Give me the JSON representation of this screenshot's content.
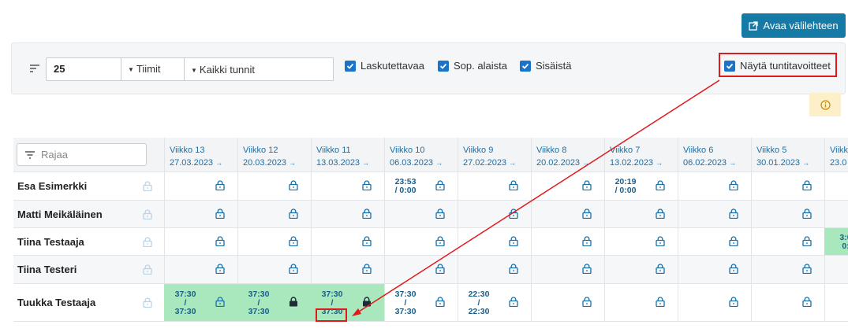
{
  "header": {
    "open_tab_label": "Avaa välilehteen"
  },
  "filters": {
    "count_value": "25",
    "team_select": "Tiimit",
    "hours_select": "Kaikki tunnit",
    "checkboxes": [
      {
        "label": "Laskutettavaa",
        "checked": true
      },
      {
        "label": "Sop. alaista",
        "checked": true
      },
      {
        "label": "Sisäistä",
        "checked": true
      }
    ],
    "show_targets_label": "Näytä tuntitavoitteet",
    "show_targets_checked": true
  },
  "table": {
    "search_placeholder": "Rajaa",
    "weeks": [
      {
        "label": "Viikko 13",
        "date": "27.03.2023"
      },
      {
        "label": "Viikko 12",
        "date": "20.03.2023"
      },
      {
        "label": "Viikko 11",
        "date": "13.03.2023"
      },
      {
        "label": "Viikko 10",
        "date": "06.03.2023"
      },
      {
        "label": "Viikko 9",
        "date": "27.02.2023"
      },
      {
        "label": "Viikko 8",
        "date": "20.02.2023"
      },
      {
        "label": "Viikko 7",
        "date": "13.02.2023"
      },
      {
        "label": "Viikko 6",
        "date": "06.02.2023"
      },
      {
        "label": "Viikko 5",
        "date": "30.01.2023"
      },
      {
        "label": "Viikk",
        "date": "23.0"
      }
    ],
    "week_arrow": "→",
    "rows": [
      {
        "name": "Esa Esimerkki",
        "cells": [
          {
            "v1": "",
            "v2": "",
            "v3": ""
          },
          {
            "v1": "",
            "v2": "",
            "v3": ""
          },
          {
            "v1": "",
            "v2": "",
            "v3": ""
          },
          {
            "v1": "23:53",
            "v2": "/ 0:00",
            "v3": ""
          },
          {
            "v1": "",
            "v2": "",
            "v3": ""
          },
          {
            "v1": "",
            "v2": "",
            "v3": ""
          },
          {
            "v1": "20:19",
            "v2": "/ 0:00",
            "v3": ""
          },
          {
            "v1": "",
            "v2": "",
            "v3": ""
          },
          {
            "v1": "",
            "v2": "",
            "v3": ""
          },
          {
            "v1": "",
            "v2": "",
            "v3": ""
          }
        ]
      },
      {
        "name": "Matti Meikäläinen",
        "cells": [
          {
            "v1": "",
            "v2": "",
            "v3": ""
          },
          {
            "v1": "",
            "v2": "",
            "v3": ""
          },
          {
            "v1": "",
            "v2": "",
            "v3": ""
          },
          {
            "v1": "",
            "v2": "",
            "v3": ""
          },
          {
            "v1": "",
            "v2": "",
            "v3": ""
          },
          {
            "v1": "",
            "v2": "",
            "v3": ""
          },
          {
            "v1": "",
            "v2": "",
            "v3": ""
          },
          {
            "v1": "",
            "v2": "",
            "v3": ""
          },
          {
            "v1": "",
            "v2": "",
            "v3": ""
          },
          {
            "v1": "",
            "v2": "",
            "v3": ""
          }
        ]
      },
      {
        "name": "Tiina Testaaja",
        "cells": [
          {
            "v1": "",
            "v2": "",
            "v3": ""
          },
          {
            "v1": "",
            "v2": "",
            "v3": ""
          },
          {
            "v1": "",
            "v2": "",
            "v3": ""
          },
          {
            "v1": "",
            "v2": "",
            "v3": ""
          },
          {
            "v1": "",
            "v2": "",
            "v3": ""
          },
          {
            "v1": "",
            "v2": "",
            "v3": ""
          },
          {
            "v1": "",
            "v2": "",
            "v3": ""
          },
          {
            "v1": "",
            "v2": "",
            "v3": ""
          },
          {
            "v1": "",
            "v2": "",
            "v3": ""
          },
          {
            "v1": "3:0",
            "v2": "0:",
            "v3": ""
          }
        ]
      },
      {
        "name": "Tiina Testeri",
        "cells": [
          {
            "v1": "",
            "v2": "",
            "v3": ""
          },
          {
            "v1": "",
            "v2": "",
            "v3": ""
          },
          {
            "v1": "",
            "v2": "",
            "v3": ""
          },
          {
            "v1": "",
            "v2": "",
            "v3": ""
          },
          {
            "v1": "",
            "v2": "",
            "v3": ""
          },
          {
            "v1": "",
            "v2": "",
            "v3": ""
          },
          {
            "v1": "",
            "v2": "",
            "v3": ""
          },
          {
            "v1": "",
            "v2": "",
            "v3": ""
          },
          {
            "v1": "",
            "v2": "",
            "v3": ""
          },
          {
            "v1": "",
            "v2": "",
            "v3": ""
          }
        ]
      },
      {
        "name": "Tuukka Testaaja",
        "cells": [
          {
            "v1": "37:30",
            "v2": "/",
            "v3": "37:30"
          },
          {
            "v1": "37:30",
            "v2": "/",
            "v3": "37:30"
          },
          {
            "v1": "37:30",
            "v2": "/",
            "v3": "37:30"
          },
          {
            "v1": "37:30",
            "v2": "/",
            "v3": "37:30"
          },
          {
            "v1": "22:30",
            "v2": "/",
            "v3": "22:30"
          },
          {
            "v1": "",
            "v2": "",
            "v3": ""
          },
          {
            "v1": "",
            "v2": "",
            "v3": ""
          },
          {
            "v1": "",
            "v2": "",
            "v3": ""
          },
          {
            "v1": "",
            "v2": "",
            "v3": ""
          },
          {
            "v1": "",
            "v2": "",
            "v3": ""
          }
        ]
      }
    ]
  },
  "colors": {
    "accent": "#157aa6",
    "checkbox": "#1a73c8",
    "target_met_cell": "#a9e8bd",
    "annotation_red": "#e0191c",
    "info_bg": "#fdf0c8"
  },
  "icons": [
    "external-link-icon",
    "sort-icon",
    "caret-down-icon",
    "checkbox-check-icon",
    "info-icon",
    "filter-icon",
    "lock-icon"
  ]
}
